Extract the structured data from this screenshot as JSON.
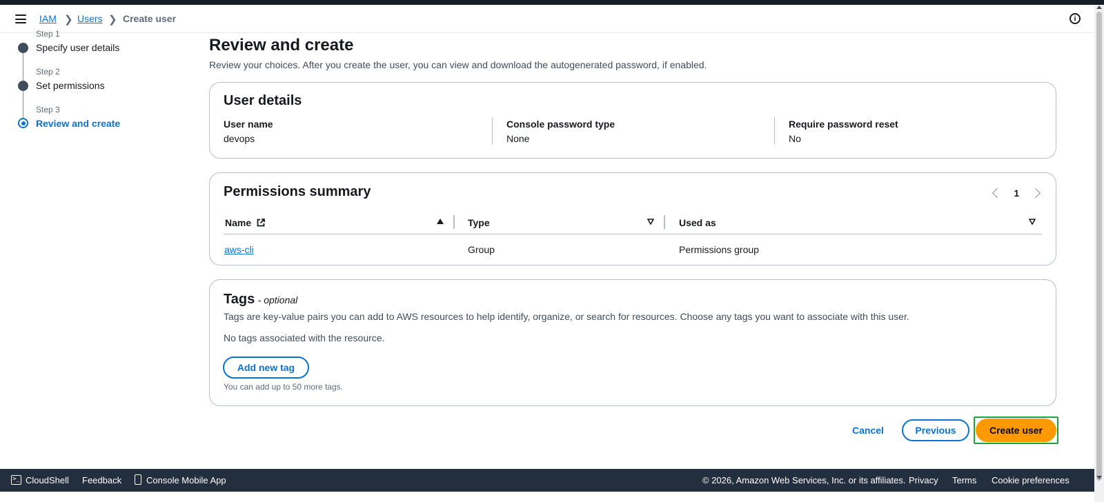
{
  "breadcrumb": {
    "items": [
      "IAM",
      "Users"
    ],
    "current": "Create user"
  },
  "steps": [
    {
      "num": "Step 1",
      "title": "Specify user details"
    },
    {
      "num": "Step 2",
      "title": "Set permissions"
    },
    {
      "num": "Step 3",
      "title": "Review and create"
    }
  ],
  "page": {
    "title": "Review and create",
    "description": "Review your choices. After you create the user, you can view and download the autogenerated password, if enabled."
  },
  "user_details": {
    "title": "User details",
    "fields": [
      {
        "label": "User name",
        "value": "devops"
      },
      {
        "label": "Console password type",
        "value": "None"
      },
      {
        "label": "Require password reset",
        "value": "No"
      }
    ]
  },
  "permissions": {
    "title": "Permissions summary",
    "page": "1",
    "columns": [
      "Name",
      "Type",
      "Used as"
    ],
    "rows": [
      {
        "name": "aws-cli",
        "type": "Group",
        "used_as": "Permissions group"
      }
    ]
  },
  "tags": {
    "title": "Tags",
    "optional": "- optional",
    "description": "Tags are key-value pairs you can add to AWS resources to help identify, organize, or search for resources. Choose any tags you want to associate with this user.",
    "empty": "No tags associated with the resource.",
    "add_button": "Add new tag",
    "hint": "You can add up to 50 more tags."
  },
  "actions": {
    "cancel": "Cancel",
    "previous": "Previous",
    "create": "Create user"
  },
  "footer": {
    "cloudshell": "CloudShell",
    "feedback": "Feedback",
    "mobile_app": "Console Mobile App",
    "copyright": "© 2026, Amazon Web Services, Inc. or its affiliates.",
    "privacy": "Privacy",
    "terms": "Terms",
    "cookies": "Cookie preferences"
  },
  "colors": {
    "accent": "#0972d3",
    "primary_button": "#ff9900",
    "footer_bg": "#232f3e",
    "highlight": "#1aa33b"
  }
}
